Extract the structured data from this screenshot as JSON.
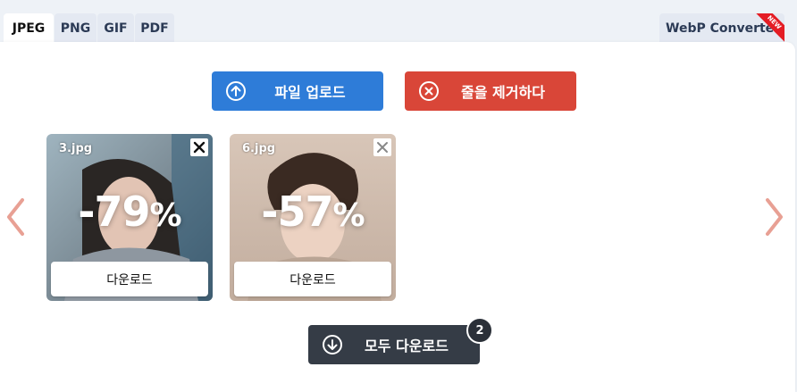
{
  "tabs": [
    {
      "label": "JPEG",
      "active": true
    },
    {
      "label": "PNG",
      "active": false
    },
    {
      "label": "GIF",
      "active": false
    },
    {
      "label": "PDF",
      "active": false
    }
  ],
  "webp_tab": {
    "label": "WebP Converter",
    "badge": "NEW"
  },
  "toolbar": {
    "upload_label": "파일 업로드",
    "clear_label": "줄을 제거하다"
  },
  "files": [
    {
      "name": "3.jpg",
      "reduction": "-79",
      "unit": "%",
      "download_label": "다운로드"
    },
    {
      "name": "6.jpg",
      "reduction": "-57",
      "unit": "%",
      "download_label": "다운로드"
    }
  ],
  "download_all": {
    "label": "모두 다운로드",
    "count": "2"
  },
  "colors": {
    "upload": "#2e7cd8",
    "clear": "#d94638",
    "download_all": "#353c46",
    "arrows": "#e8a094"
  },
  "icons": {
    "upload": "arrow-up-circle-icon",
    "clear": "x-circle-icon",
    "download_all": "arrow-down-circle-icon",
    "prev": "chevron-left-icon",
    "next": "chevron-right-icon",
    "remove": "close-icon"
  }
}
